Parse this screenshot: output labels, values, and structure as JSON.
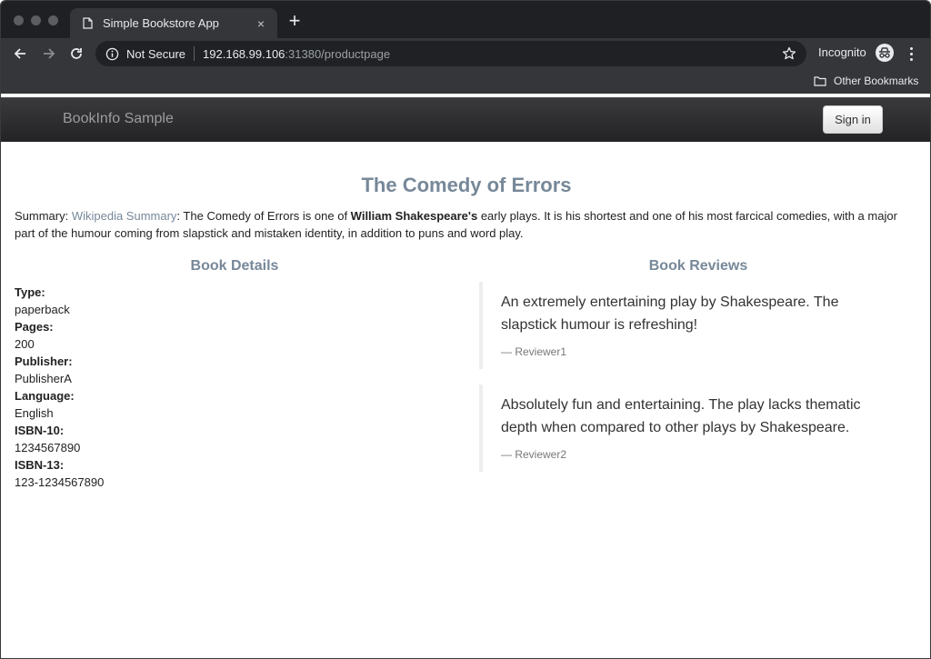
{
  "browser": {
    "tab_title": "Simple Bookstore App",
    "tab_close": "×",
    "new_tab": "+",
    "security": "Not Secure",
    "url_host": "192.168.99.106",
    "url_path": ":31380/productpage",
    "mode": "Incognito",
    "bookmark_folder": "Other Bookmarks"
  },
  "app": {
    "brand": "BookInfo Sample",
    "signin_label": "Sign in"
  },
  "book": {
    "title": "The Comedy of Errors",
    "summary_prefix": "Summary: ",
    "summary_link": "Wikipedia Summary",
    "summary_text1": ": The Comedy of Errors is one of ",
    "summary_bold": "William Shakespeare's",
    "summary_text2": " early plays. It is his shortest and one of his most farcical comedies, with a major part of the humour coming from slapstick and mistaken identity, in addition to puns and word play."
  },
  "details": {
    "heading": "Book Details",
    "items": [
      {
        "label": "Type:",
        "value": "paperback"
      },
      {
        "label": "Pages:",
        "value": "200"
      },
      {
        "label": "Publisher:",
        "value": "PublisherA"
      },
      {
        "label": "Language:",
        "value": "English"
      },
      {
        "label": "ISBN-10:",
        "value": "1234567890"
      },
      {
        "label": "ISBN-13:",
        "value": "123-1234567890"
      }
    ]
  },
  "reviews": {
    "heading": "Book Reviews",
    "items": [
      {
        "text": "An extremely entertaining play by Shakespeare. The slapstick humour is refreshing!",
        "author": "— Reviewer1"
      },
      {
        "text": "Absolutely fun and entertaining. The play lacks thematic depth when compared to other plays by Shakespeare.",
        "author": "— Reviewer2"
      }
    ]
  }
}
